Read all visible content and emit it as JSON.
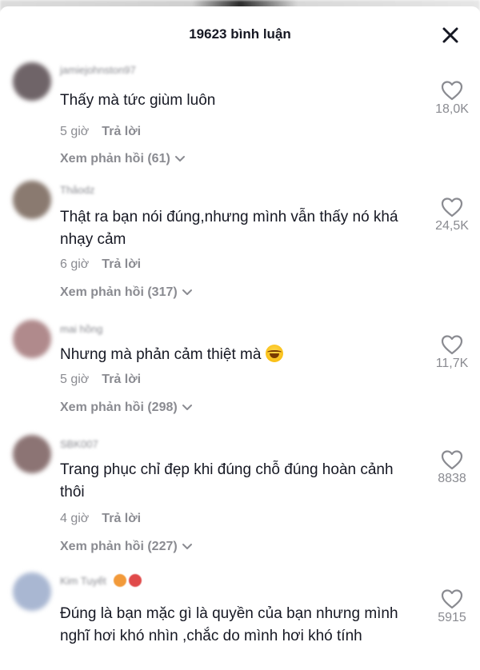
{
  "header": {
    "title": "19623 bình luận"
  },
  "comments": [
    {
      "username": "jamiejohnston97",
      "text": "Thấy mà tức giùm luôn",
      "time": "5 giờ",
      "reply_label": "Trả lời",
      "view_replies": "Xem phản hồi (61)",
      "likes": "18,0K",
      "avatar_color": "#6f6468"
    },
    {
      "username": "Thảodz",
      "text": "Thật ra bạn nói đúng,nhưng mình vẫn thấy nó khá nhạy cảm",
      "time": "6 giờ",
      "reply_label": "Trả lời",
      "view_replies": "Xem phản hồi (317)",
      "likes": "24,5K",
      "avatar_color": "#8a7a70"
    },
    {
      "username": "mai hồng",
      "text": "Nhưng mà phản cảm thiệt mà",
      "time": "5 giờ",
      "reply_label": "Trả lời",
      "view_replies": "Xem phản hồi (298)",
      "likes": "11,7K",
      "avatar_color": "#b08a8c"
    },
    {
      "username": "SBK007",
      "text": "Trang phục chỉ đẹp khi đúng chỗ đúng hoàn cảnh thôi",
      "time": "4 giờ",
      "reply_label": "Trả lời",
      "view_replies": "Xem phản hồi (227)",
      "likes": "8838",
      "avatar_color": "#8c7474"
    },
    {
      "username": "Kim Tuyết",
      "text": "Đúng là bạn mặc gì là quyền của bạn nhưng mình nghĩ hơi khó nhìn ,chắc do mình hơi khó tính",
      "likes": "5915",
      "avatar_color": "#a9b7d2"
    }
  ],
  "icons": {
    "close": "close-icon",
    "like": "heart-outline-icon",
    "chevron": "chevron-down-icon",
    "emoji": "laughing-tears-emoji"
  },
  "colors": {
    "primary_text": "#161823",
    "secondary_text": "#8a8b91",
    "background": "#ffffff"
  }
}
